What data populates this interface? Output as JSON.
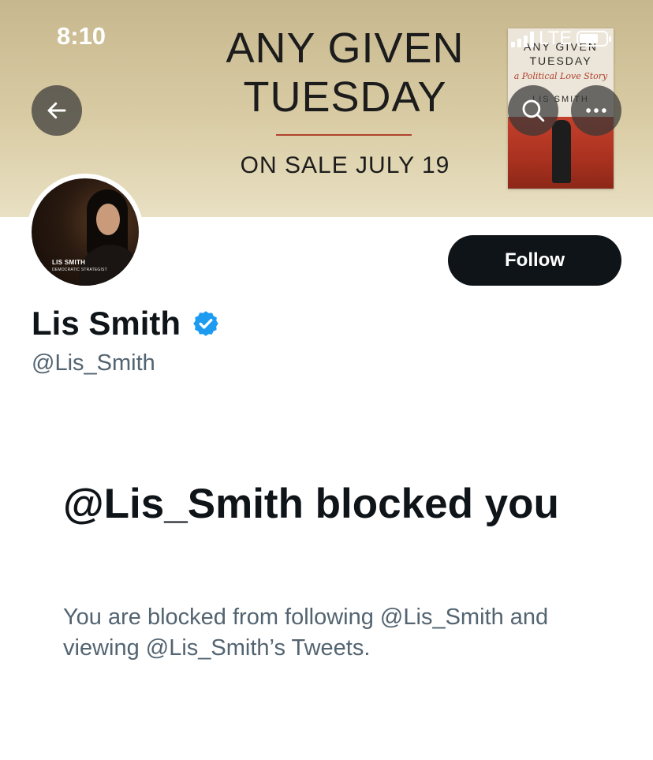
{
  "status_bar": {
    "time": "8:10",
    "network": "LTE"
  },
  "banner": {
    "title_line1": "ANY GIVEN",
    "title_line2": "TUESDAY",
    "subtitle": "ON SALE JULY 19",
    "book": {
      "title_line1": "ANY GIVEN",
      "title_line2": "TUESDAY",
      "tagline": "a Political Love Story",
      "author": "LIS SMITH"
    }
  },
  "profile": {
    "avatar_caption_name": "LIS SMITH",
    "avatar_caption_role": "DEMOCRATIC STRATEGIST",
    "display_name": "Lis Smith",
    "handle": "@Lis_Smith",
    "verified": true,
    "follow_label": "Follow"
  },
  "blocked": {
    "title": "@Lis_Smith blocked you",
    "description": "You are blocked from following @Lis_Smith and viewing @Lis_Smith’s Tweets."
  },
  "icons": {
    "back": "arrow-left-icon",
    "search": "search-icon",
    "more": "more-horizontal-icon",
    "verified": "verified-badge-icon"
  },
  "colors": {
    "follow_button": "#0f1419",
    "verified": "#1d9bf0",
    "secondary_text": "#536471"
  }
}
